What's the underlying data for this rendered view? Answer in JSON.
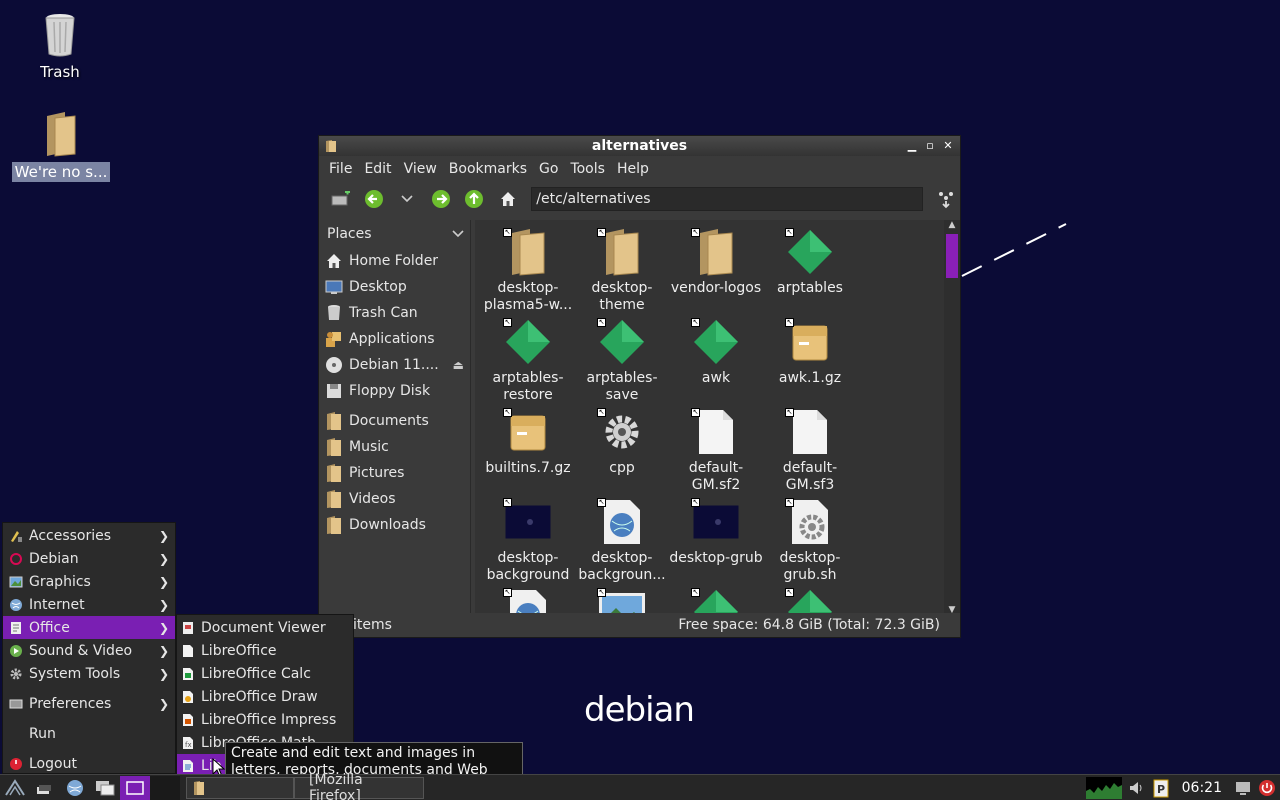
{
  "desktop": {
    "trash_label": "Trash",
    "folder_label": "We're no s...",
    "brand": "debian"
  },
  "window": {
    "title": "alternatives",
    "menus": [
      "File",
      "Edit",
      "View",
      "Bookmarks",
      "Go",
      "Tools",
      "Help"
    ],
    "path": "/etc/alternatives",
    "places_label": "Places",
    "places": [
      {
        "label": "Home Folder",
        "icon": "home-icon"
      },
      {
        "label": "Desktop",
        "icon": "desktop-icon"
      },
      {
        "label": "Trash Can",
        "icon": "trash-icon"
      },
      {
        "label": "Applications",
        "icon": "applications-icon"
      },
      {
        "label": "Debian 11....",
        "icon": "cdrom-icon"
      },
      {
        "label": "Floppy Disk",
        "icon": "floppy-icon"
      }
    ],
    "bookmarks": [
      {
        "label": "Documents"
      },
      {
        "label": "Music"
      },
      {
        "label": "Pictures"
      },
      {
        "label": "Videos"
      },
      {
        "label": "Downloads"
      }
    ],
    "files": [
      {
        "line1": "desktop-",
        "line2": "plasma5-w...",
        "icon": "folder"
      },
      {
        "line1": "desktop-",
        "line2": "theme",
        "icon": "folder"
      },
      {
        "line1": "vendor-logos",
        "line2": "",
        "icon": "folder"
      },
      {
        "line1": "arptables",
        "line2": "",
        "icon": "exec"
      },
      {
        "line1": "arptables-",
        "line2": "restore",
        "icon": "exec"
      },
      {
        "line1": "arptables-",
        "line2": "save",
        "icon": "exec"
      },
      {
        "line1": "awk",
        "line2": "",
        "icon": "exec"
      },
      {
        "line1": "awk.1.gz",
        "line2": "",
        "icon": "archive"
      },
      {
        "line1": "builtins.7.gz",
        "line2": "",
        "icon": "archive"
      },
      {
        "line1": "cpp",
        "line2": "",
        "icon": "gear"
      },
      {
        "line1": "default-",
        "line2": "GM.sf2",
        "icon": "doc"
      },
      {
        "line1": "default-",
        "line2": "GM.sf3",
        "icon": "doc"
      },
      {
        "line1": "desktop-",
        "line2": "background",
        "icon": "image-dark"
      },
      {
        "line1": "desktop-",
        "line2": "backgroun...",
        "icon": "globe-doc"
      },
      {
        "line1": "desktop-grub",
        "line2": "",
        "icon": "image-dark"
      },
      {
        "line1": "desktop-",
        "line2": "grub.sh",
        "icon": "gear-doc"
      },
      {
        "line1": "",
        "line2": "",
        "icon": "globe-doc"
      },
      {
        "line1": "",
        "line2": "",
        "icon": "picture"
      },
      {
        "line1": "",
        "line2": "",
        "icon": "exec"
      },
      {
        "line1": "",
        "line2": "",
        "icon": "exec"
      }
    ],
    "status_left": "items",
    "status_right": "Free space: 64.8 GiB (Total: 72.3 GiB)"
  },
  "startmenu": {
    "items": [
      {
        "label": "Accessories",
        "has_sub": true
      },
      {
        "label": "Debian",
        "has_sub": true
      },
      {
        "label": "Graphics",
        "has_sub": true
      },
      {
        "label": "Internet",
        "has_sub": true
      },
      {
        "label": "Office",
        "has_sub": true,
        "active": true
      },
      {
        "label": "Sound & Video",
        "has_sub": true
      },
      {
        "label": "System Tools",
        "has_sub": true
      }
    ],
    "preferences": "Preferences",
    "run": "Run",
    "logout": "Logout"
  },
  "office_submenu": [
    {
      "label": "Document Viewer"
    },
    {
      "label": "LibreOffice"
    },
    {
      "label": "LibreOffice Calc"
    },
    {
      "label": "LibreOffice Draw"
    },
    {
      "label": "LibreOffice Impress"
    },
    {
      "label": "LibreOffice Math"
    },
    {
      "label": "Lib"
    }
  ],
  "tooltip": "Create and edit text and images in letters, reports, documents and Web pages by using Writer.",
  "taskbar": {
    "task_firefox": "[Mozilla Firefox]",
    "clock": "06:21"
  },
  "colors": {
    "desktop_bg": "#0b0b36",
    "accent": "#7a1fb3"
  }
}
